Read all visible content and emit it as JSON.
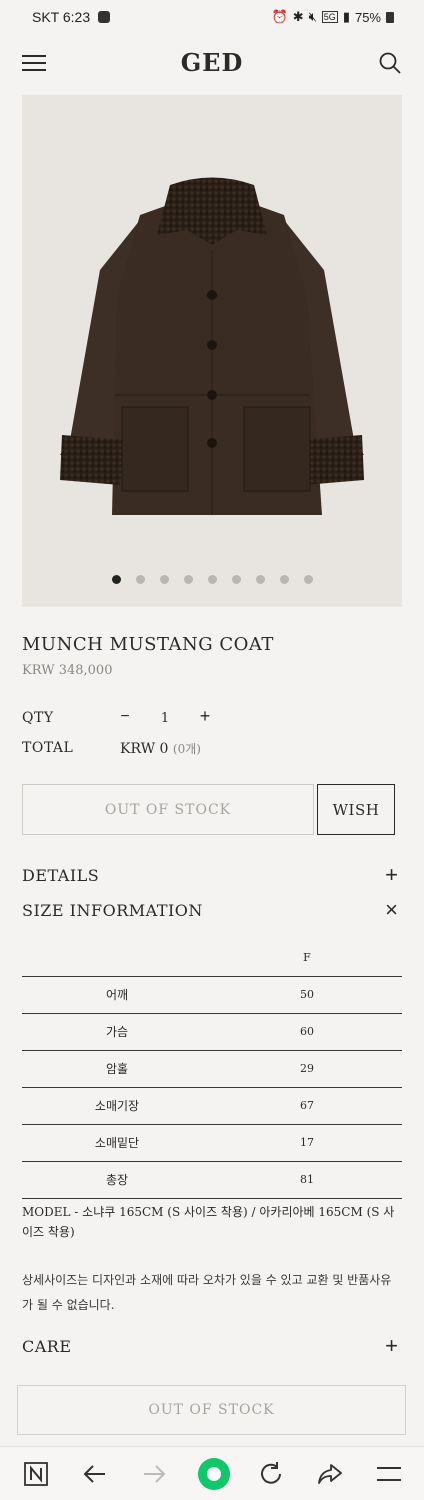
{
  "status_bar": {
    "carrier_time": "SKT 6:23",
    "battery": "75%",
    "network": "5G"
  },
  "header": {
    "logo": "GED"
  },
  "product": {
    "title": "MUNCH MUSTANG COAT",
    "price": "KRW 348,000",
    "carousel": {
      "total": 9,
      "active": 1
    }
  },
  "order": {
    "qty_label": "QTY",
    "qty_minus": "−",
    "qty_value": "1",
    "qty_plus": "+",
    "total_label": "TOTAL",
    "total_value": "KRW 0",
    "total_count": "(0개)"
  },
  "actions": {
    "out_of_stock": "OUT OF STOCK",
    "wish": "WISH"
  },
  "sections": {
    "details": {
      "label": "DETAILS",
      "toggle": "+"
    },
    "size_information": {
      "label": "SIZE INFORMATION",
      "toggle": "×"
    },
    "care": {
      "label": "CARE",
      "toggle": "+"
    }
  },
  "size_table": {
    "headers": [
      "",
      "F"
    ],
    "rows": [
      {
        "name": "어깨",
        "value": "50"
      },
      {
        "name": "가슴",
        "value": "60"
      },
      {
        "name": "암홀",
        "value": "29"
      },
      {
        "name": "소매기장",
        "value": "67"
      },
      {
        "name": "소매밑단",
        "value": "17"
      },
      {
        "name": "총장",
        "value": "81"
      }
    ]
  },
  "notes": {
    "model": "MODEL - 소냐쿠 165CM (S 사이즈 착용) / 아카리아베 165CM (S 사이즈 착용)",
    "size_disclaimer": "상세사이즈는 디자인과 소재에 따라 오차가 있을 수 있고 교환 및 반품사유가 될 수 없습니다."
  },
  "bottom_button": {
    "label": "OUT OF STOCK"
  },
  "colors": {
    "background": "#f4f3f1",
    "image_background": "#e8e5e0",
    "text": "#2c2a27",
    "muted": "#8a8782",
    "browser_accent": "#10c76a"
  },
  "browser_bar": {
    "icons": [
      "naver-home-icon",
      "back-arrow-icon",
      "forward-arrow-icon",
      "green-dot-icon",
      "refresh-icon",
      "share-icon",
      "menu-icon"
    ]
  }
}
